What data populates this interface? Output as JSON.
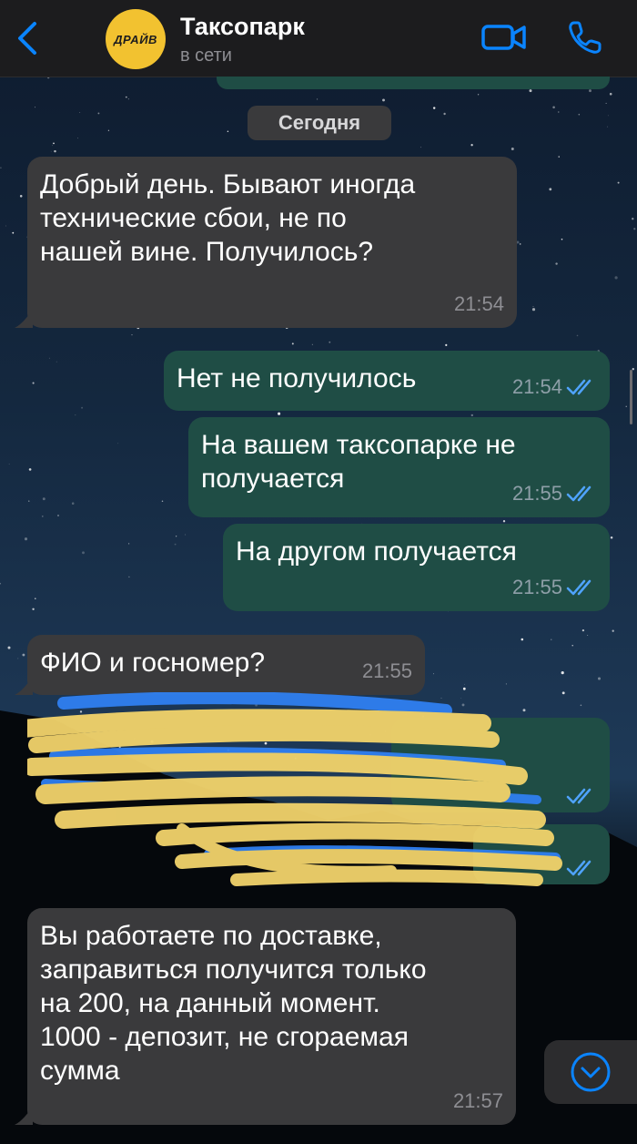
{
  "header": {
    "contact_name": "Таксопарк",
    "status": "в сети",
    "avatar_text": "ДРАЙВ",
    "accent_color": "#0a84ff",
    "icons": [
      "chevron-left-icon",
      "video-camera-icon",
      "phone-icon"
    ]
  },
  "chat": {
    "date_label": "Сегодня",
    "messages": [
      {
        "direction": "incoming",
        "text": "Добрый день.  Бывают иногда\nтехнические сбои, не по\nнашей вине. Получилось?",
        "time": "21:54"
      },
      {
        "direction": "outgoing",
        "text": "Нет не получилось",
        "time": "21:54",
        "status": "read"
      },
      {
        "direction": "outgoing",
        "text": "На вашем таксопарке не\nполучается",
        "time": "21:55",
        "status": "read"
      },
      {
        "direction": "outgoing",
        "text": "На другом получается",
        "time": "21:55",
        "status": "read"
      },
      {
        "direction": "incoming",
        "text": "ФИО и госномер?",
        "time": "21:55"
      },
      {
        "direction": "outgoing",
        "text": "",
        "time": "",
        "status": "read",
        "redacted": true
      },
      {
        "direction": "outgoing",
        "text": "",
        "time": "",
        "status": "read",
        "redacted": true
      },
      {
        "direction": "incoming",
        "text": "Вы работаете по доставке,\nзаправиться получится только\nна 200, на данный момент.\n1000 - депозит, не сгораемая\nсумма",
        "time": "21:57"
      }
    ]
  },
  "colors": {
    "incoming_bubble": "#3a3a3c",
    "outgoing_bubble": "#1f4d45",
    "read_check": "#4fa3ff",
    "scribble_yellow": "#f2d36b",
    "scribble_blue": "#2f7ff0"
  }
}
